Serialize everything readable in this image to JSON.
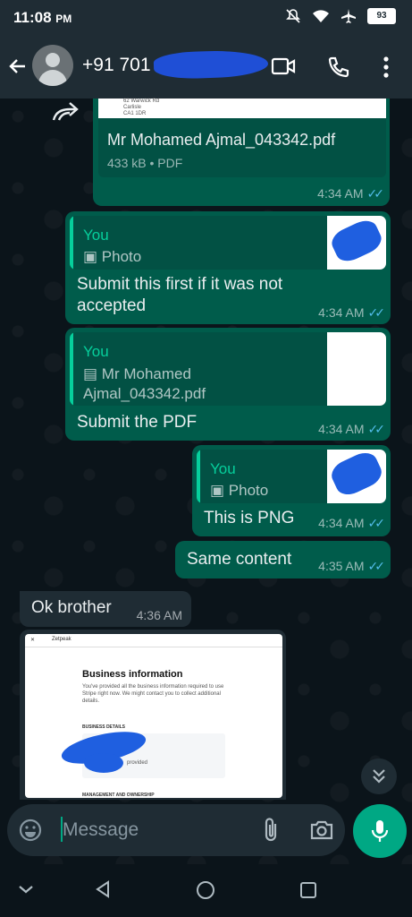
{
  "status_bar": {
    "time": "11:08",
    "ampm": "PM",
    "battery": "93"
  },
  "header": {
    "contact": "+91 701",
    "icons": [
      "back-arrow-icon",
      "video-call-icon",
      "phone-icon",
      "more-icon"
    ]
  },
  "messages": {
    "pdf_card": {
      "filename": "Mr Mohamed Ajmal_043342.pdf",
      "meta": "433 kB • PDF",
      "time": "4:34 AM",
      "preview_lines": [
        "62 Warwick Rd",
        "Carlisle",
        "CA1 1DR"
      ]
    },
    "msg1": {
      "quote_author": "You",
      "quote_text": "Photo",
      "text_line1": "Submit this first if it was not",
      "text_line2": "accepted",
      "time": "4:34 AM"
    },
    "msg2": {
      "quote_author": "You",
      "quote_text_line1": "Mr Mohamed",
      "quote_text_line2": "Ajmal_043342.pdf",
      "text": "Submit the PDF",
      "time": "4:34 AM"
    },
    "msg3": {
      "quote_author": "You",
      "quote_text": "Photo",
      "text": "This is PNG",
      "time": "4:34 AM"
    },
    "msg4": {
      "text": "Same content",
      "time": "4:35 AM"
    },
    "msg5": {
      "text": "Ok brother",
      "time": "4:36 AM"
    },
    "image": {
      "tab": "Zetpeak",
      "title": "Business information",
      "desc": "You've provided all the business information required to use Stripe right now. We might contact you to collect additional details.",
      "section1": "BUSINESS DETAILS",
      "row_text": "provided",
      "section2": "MANAGEMENT AND OWNERSHIP"
    }
  },
  "input": {
    "placeholder": "Message"
  },
  "colors": {
    "outgoing": "#005c4b",
    "incoming": "#1f2c34",
    "accent": "#00a884",
    "read_ticks": "#53bdeb"
  }
}
